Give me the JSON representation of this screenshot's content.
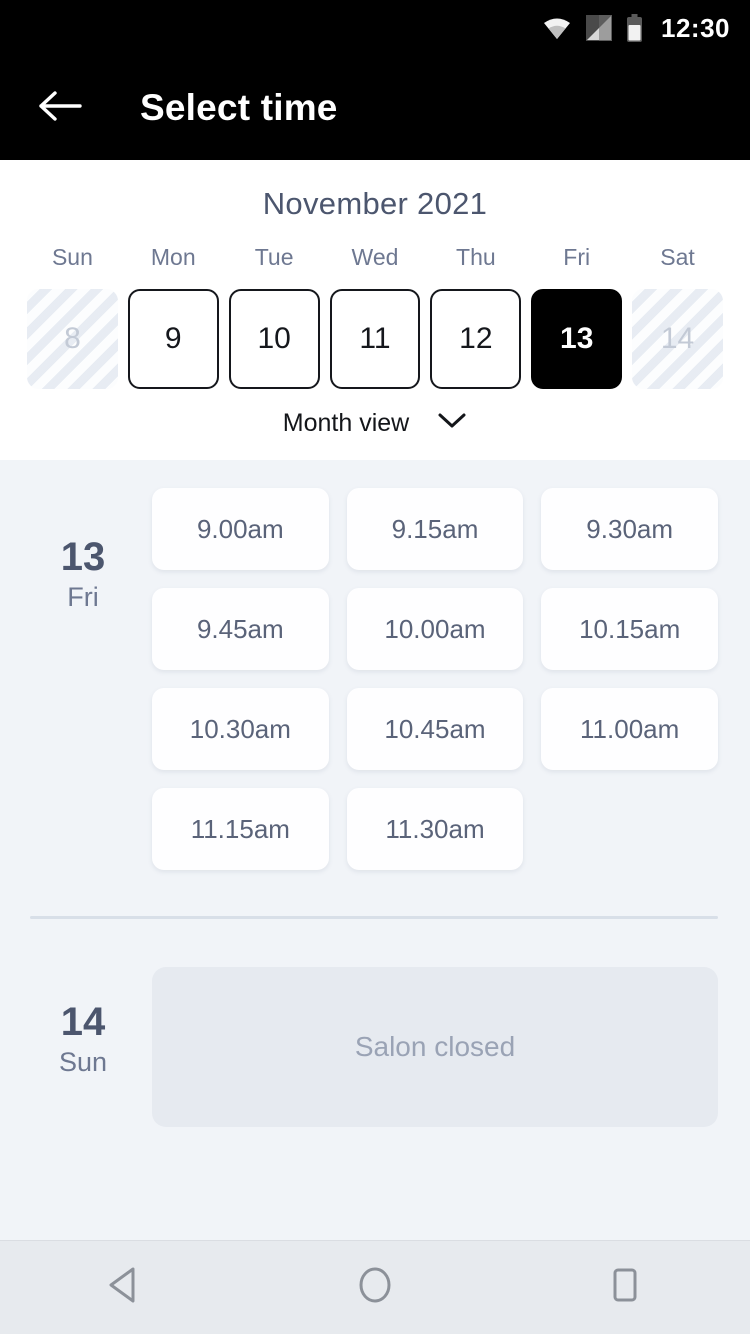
{
  "status_bar": {
    "time": "12:30",
    "icons": [
      "wifi-icon",
      "cellular-signal-icon",
      "battery-icon"
    ]
  },
  "app_bar": {
    "back_icon": "arrow-left-icon",
    "title": "Select time"
  },
  "calendar": {
    "month_title": "November 2021",
    "weekday_labels": [
      "Sun",
      "Mon",
      "Tue",
      "Wed",
      "Thu",
      "Fri",
      "Sat"
    ],
    "days": [
      {
        "number": "8",
        "state": "disabled"
      },
      {
        "number": "9",
        "state": "available"
      },
      {
        "number": "10",
        "state": "available"
      },
      {
        "number": "11",
        "state": "available"
      },
      {
        "number": "12",
        "state": "available"
      },
      {
        "number": "13",
        "state": "selected"
      },
      {
        "number": "14",
        "state": "disabled"
      }
    ],
    "view_toggle": {
      "label": "Month view",
      "icon": "chevron-down-icon"
    }
  },
  "schedule": {
    "days": [
      {
        "day_number": "13",
        "day_of_week": "Fri",
        "slots": [
          "9.00am",
          "9.15am",
          "9.30am",
          "9.45am",
          "10.00am",
          "10.15am",
          "10.30am",
          "10.45am",
          "11.00am",
          "11.15am",
          "11.30am"
        ]
      },
      {
        "day_number": "14",
        "day_of_week": "Sun",
        "closed_message": "Salon closed"
      }
    ]
  },
  "nav_bar": {
    "buttons": [
      "back-triangle-icon",
      "home-circle-icon",
      "recents-square-icon"
    ]
  },
  "colors": {
    "appbar_background": "#000000",
    "selected_day_background": "#000000",
    "page_background": "#F1F4F8",
    "card_background": "#FEFEFF",
    "heading_text": "#4C566E",
    "muted_text": "#6E7891",
    "closed_card_background": "#E6EAF0"
  }
}
